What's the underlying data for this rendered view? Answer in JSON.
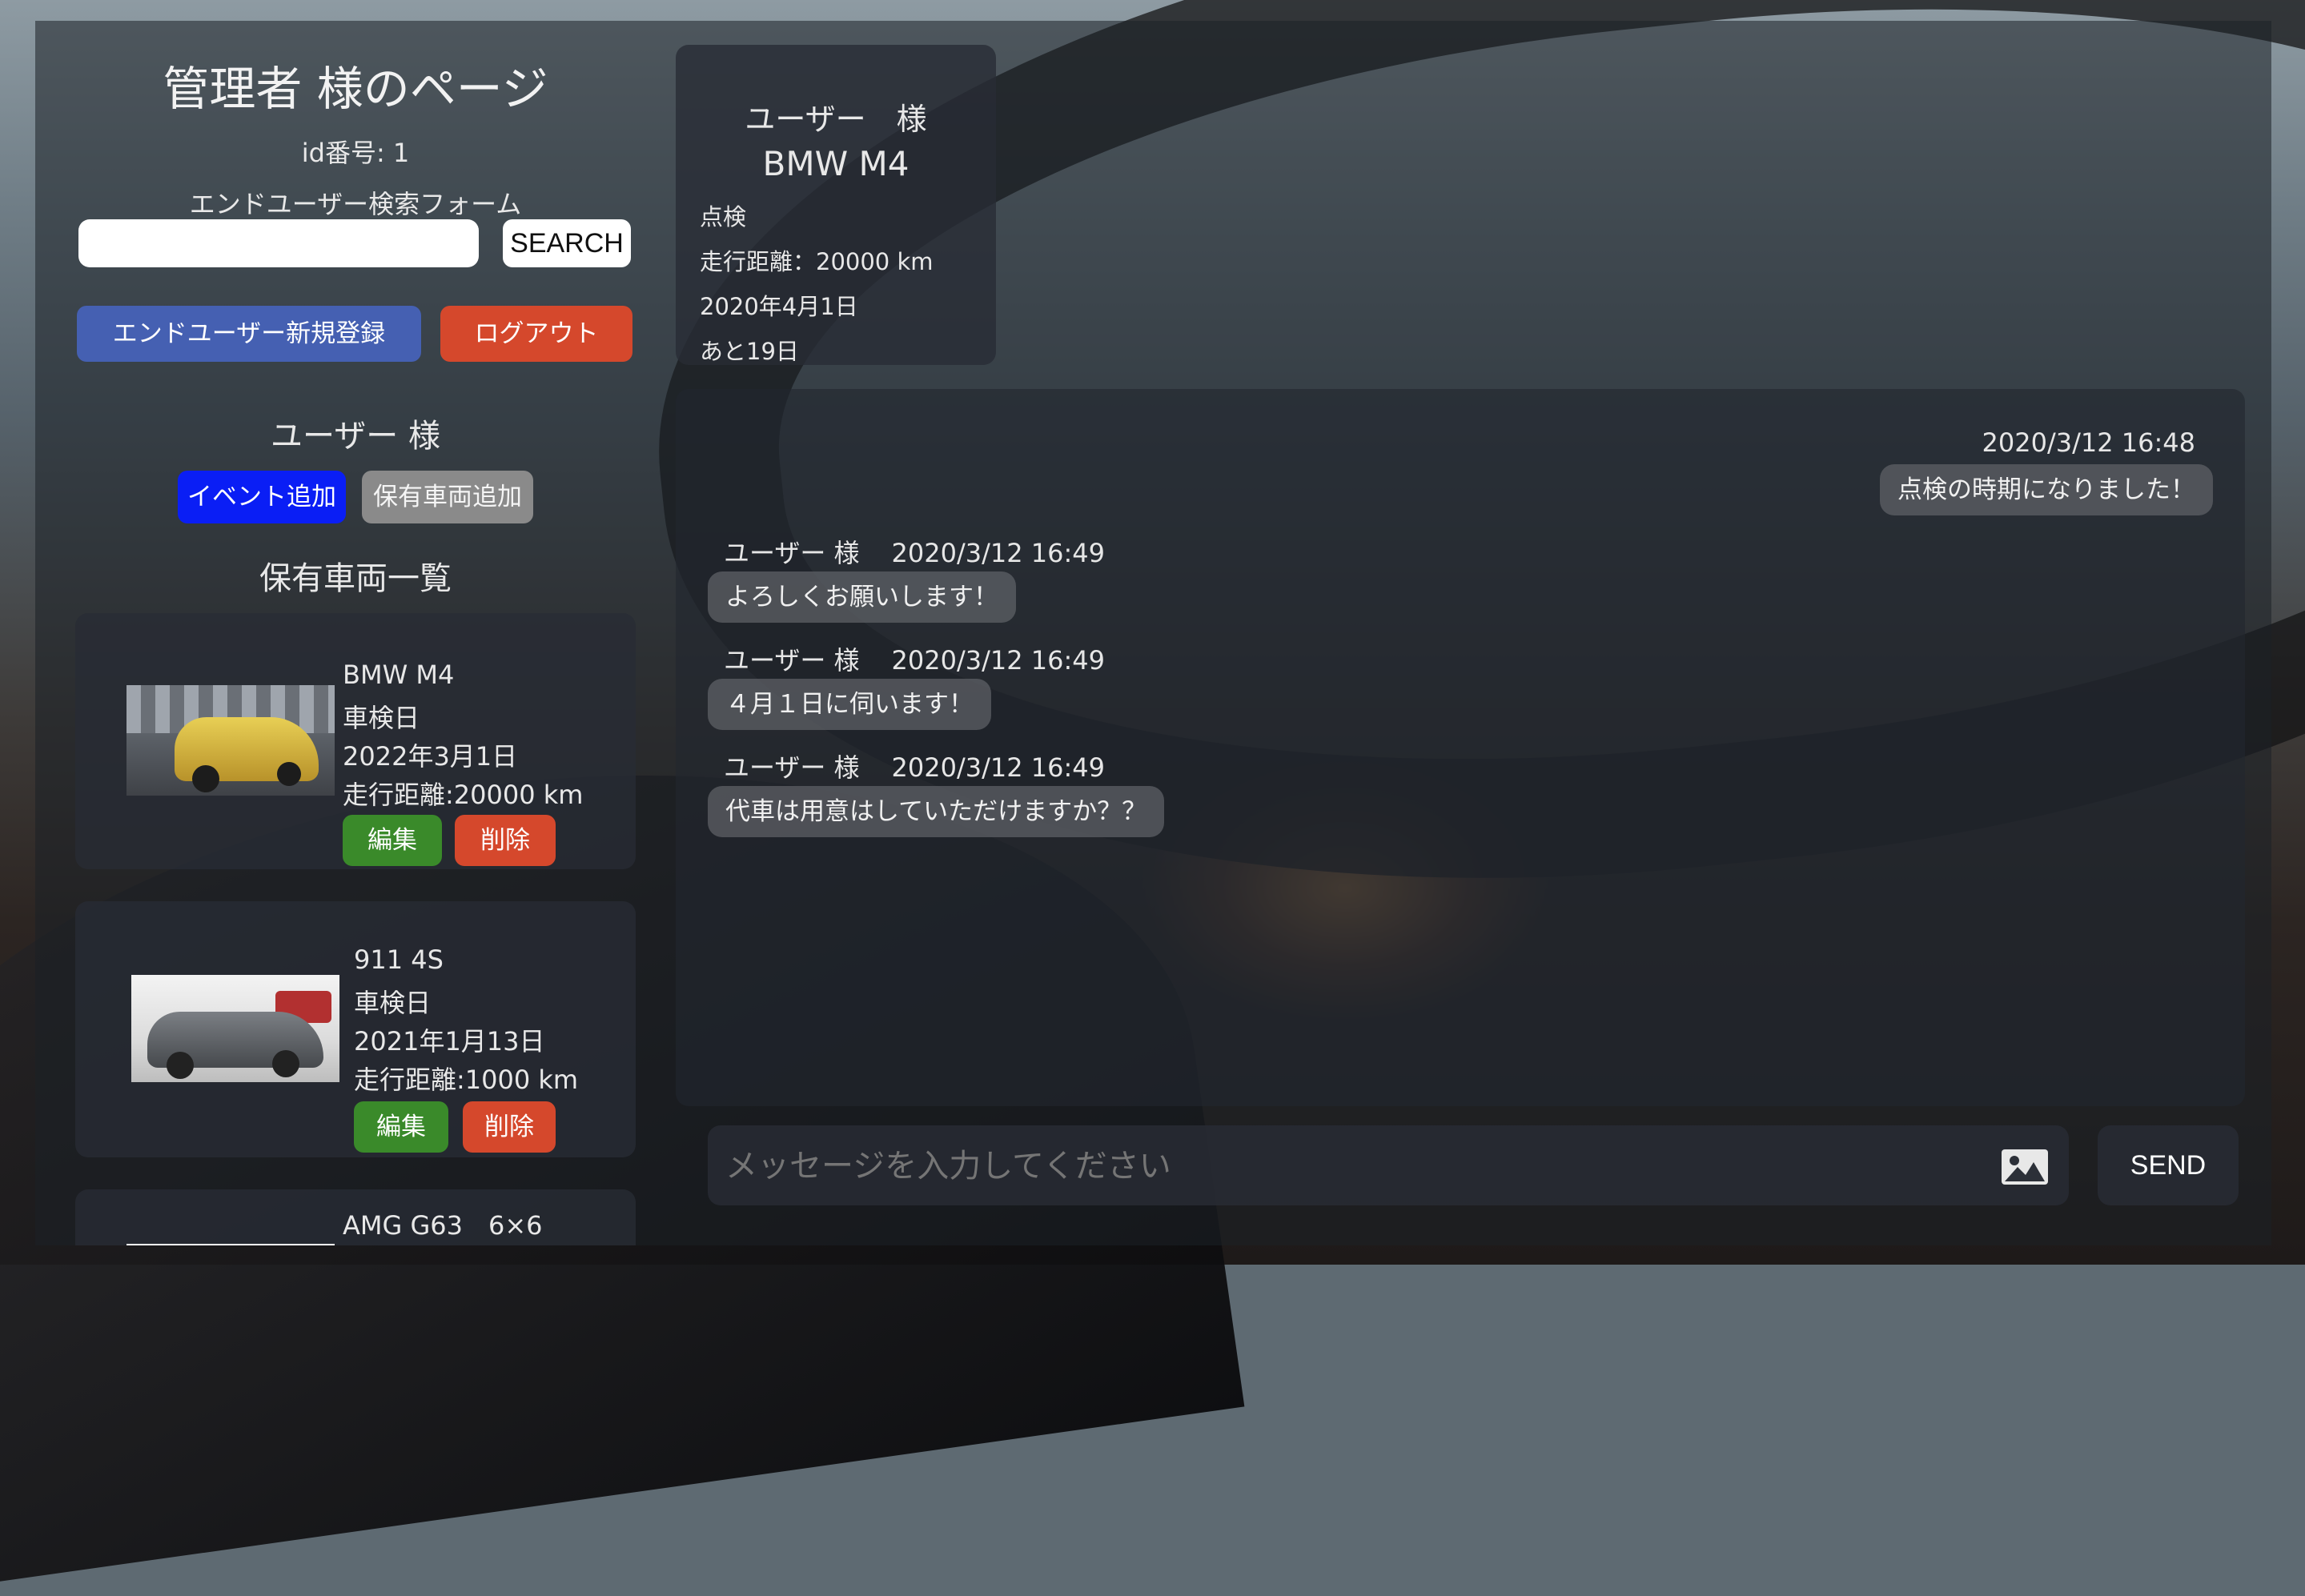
{
  "sidebar": {
    "title": "管理者 様のページ",
    "id_label": "id番号: 1",
    "search_form_label": "エンドユーザー検索フォーム",
    "search_value": "",
    "search_button": "SEARCH",
    "register_button": "エンドユーザー新規登録",
    "logout_button": "ログアウト",
    "user_heading": "ユーザー 様",
    "add_event_button": "イベント追加",
    "add_vehicle_button": "保有車両追加",
    "vehicle_list_heading": "保有車両一覧",
    "vehicles": [
      {
        "name": "BMW M4",
        "inspection_label": "車検日",
        "inspection_date": "2022年3月1日",
        "mileage": "走行距離:20000 km",
        "edit": "編集",
        "delete": "削除",
        "photo": "gold-bmw-m4-photo"
      },
      {
        "name": "911 4S",
        "inspection_label": "車検日",
        "inspection_date": "2021年1月13日",
        "mileage": "走行距離:1000 km",
        "edit": "編集",
        "delete": "削除",
        "photo": "grey-porsche-911-photo"
      },
      {
        "name": "AMG G63　6×6"
      }
    ]
  },
  "event_card": {
    "user": "ユーザー　様",
    "car": "BMW M4",
    "type": "点検",
    "mileage": "走行距離：20000 km",
    "date": "2020年4月1日",
    "remaining": "あと19日"
  },
  "chat": {
    "messages": [
      {
        "side": "right",
        "sender": "",
        "time": "2020/3/12 16:48",
        "text": "点検の時期になりました！"
      },
      {
        "side": "left",
        "sender": "ユーザー 様",
        "time": "2020/3/12 16:49",
        "text": "よろしくお願いします！"
      },
      {
        "side": "left",
        "sender": "ユーザー 様",
        "time": "2020/3/12 16:49",
        "text": "４月１日に伺います！"
      },
      {
        "side": "left",
        "sender": "ユーザー 様",
        "time": "2020/3/12 16:49",
        "text": "代車は用意はしていただけますか？？"
      }
    ],
    "input_placeholder": "メッセージを入力してください",
    "image_icon": "image-icon",
    "send_button": "SEND"
  },
  "colors": {
    "register": "#4560b2",
    "logout": "#d5482c",
    "add_event": "#0a1ef5",
    "add_vehicle": "#8a8a8a",
    "edit": "#3a8a2a",
    "delete": "#d5482c"
  }
}
